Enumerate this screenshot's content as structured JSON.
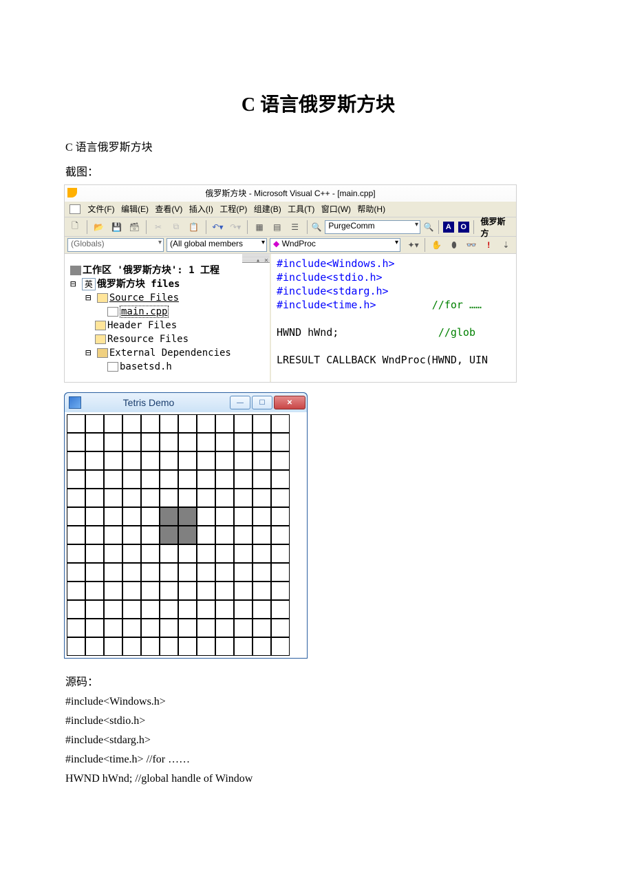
{
  "doc": {
    "title": "C 语言俄罗斯方块",
    "subtitle": "C 语言俄罗斯方块",
    "screenshot_label": "截图：",
    "source_label": "源码："
  },
  "vc6": {
    "window_title": "俄罗斯方块 - Microsoft Visual C++ - [main.cpp]",
    "menu": [
      "文件(F)",
      "编辑(E)",
      "查看(V)",
      "插入(I)",
      "工程(P)",
      "组建(B)",
      "工具(T)",
      "窗口(W)",
      "帮助(H)"
    ],
    "toolbar_text": "PurgeComm",
    "toolbar_right_text": "俄罗斯方",
    "globals": "(Globals)",
    "members": "(All global members",
    "wndproc": "WndProc",
    "tree": {
      "workspace": "工作区 '俄罗斯方块': 1 工程",
      "project": "俄罗斯方块 files",
      "source": "Source Files",
      "main": "main.cpp",
      "header": "Header Files",
      "resource": "Resource Files",
      "extdep": "External Dependencies",
      "basetsd": "basetsd.h",
      "ime": "英"
    },
    "code": {
      "l1": "#include<Windows.h>",
      "l2": "#include<stdio.h>",
      "l3": "#include<stdarg.h>",
      "l4a": "#include<time.h>",
      "l4b": "//for ……",
      "l5a": "HWND hWnd;",
      "l5b": "//glob",
      "l6": "LRESULT CALLBACK WndProc(HWND, UIN"
    }
  },
  "tetris": {
    "title": "Tetris Demo",
    "rows": 13,
    "cols": 12,
    "filled": [
      [
        5,
        5
      ],
      [
        5,
        6
      ],
      [
        6,
        5
      ],
      [
        6,
        6
      ]
    ]
  },
  "src": {
    "l1": "#include<Windows.h>",
    "l2": "#include<stdio.h>",
    "l3": "#include<stdarg.h>",
    "l4": "#include<time.h> //for ……",
    "l5": "HWND hWnd; //global handle of Window"
  }
}
